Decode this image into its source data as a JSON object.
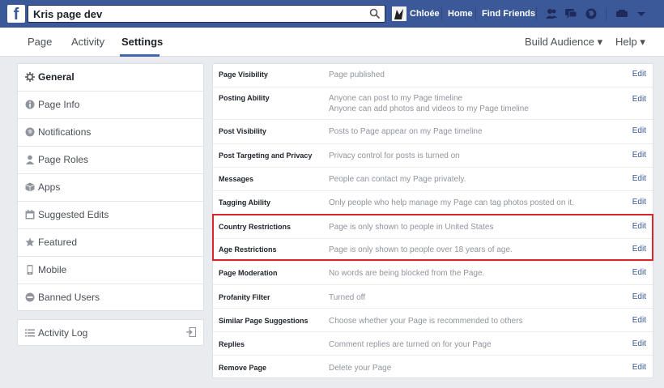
{
  "topbar": {
    "logo": "f",
    "search_value": "Kris page dev",
    "profile_name": "Chloée",
    "home_label": "Home",
    "find_friends_label": "Find Friends"
  },
  "subnav": {
    "tabs": [
      "Page",
      "Activity",
      "Settings"
    ],
    "build_audience": "Build Audience ▾",
    "help": "Help ▾"
  },
  "sidebar": {
    "items": [
      {
        "label": "General",
        "icon": "gear-icon"
      },
      {
        "label": "Page Info",
        "icon": "info-icon"
      },
      {
        "label": "Notifications",
        "icon": "globe-icon"
      },
      {
        "label": "Page Roles",
        "icon": "person-icon"
      },
      {
        "label": "Apps",
        "icon": "cube-icon"
      },
      {
        "label": "Suggested Edits",
        "icon": "calendar-icon"
      },
      {
        "label": "Featured",
        "icon": "star-icon"
      },
      {
        "label": "Mobile",
        "icon": "phone-icon"
      },
      {
        "label": "Banned Users",
        "icon": "banned-icon"
      }
    ],
    "activity_log": "Activity Log"
  },
  "settings": {
    "edit_label": "Edit",
    "rows": [
      {
        "name": "Page Visibility",
        "desc": [
          "Page published"
        ]
      },
      {
        "name": "Posting Ability",
        "desc": [
          "Anyone can post to my Page timeline",
          "Anyone can add photos and videos to my Page timeline"
        ]
      },
      {
        "name": "Post Visibility",
        "desc": [
          "Posts to Page appear on my Page timeline"
        ]
      },
      {
        "name": "Post Targeting and Privacy",
        "desc": [
          "Privacy control for posts is turned on"
        ]
      },
      {
        "name": "Messages",
        "desc": [
          "People can contact my Page privately."
        ]
      },
      {
        "name": "Tagging Ability",
        "desc": [
          "Only people who help manage my Page can tag photos posted on it."
        ]
      },
      {
        "name": "Country Restrictions",
        "desc": [
          "Page is only shown to people in United States"
        ]
      },
      {
        "name": "Age Restrictions",
        "desc": [
          "Page is only shown to people over 18 years of age."
        ]
      },
      {
        "name": "Page Moderation",
        "desc": [
          "No words are being blocked from the Page."
        ]
      },
      {
        "name": "Profanity Filter",
        "desc": [
          "Turned off"
        ]
      },
      {
        "name": "Similar Page Suggestions",
        "desc": [
          "Choose whether your Page is recommended to others"
        ]
      },
      {
        "name": "Replies",
        "desc": [
          "Comment replies are turned on for your Page"
        ]
      },
      {
        "name": "Remove Page",
        "desc": [
          "Delete your Page"
        ]
      }
    ]
  },
  "colors": {
    "brand": "#3b5998",
    "link": "#365899",
    "highlight": "#d9262c"
  }
}
